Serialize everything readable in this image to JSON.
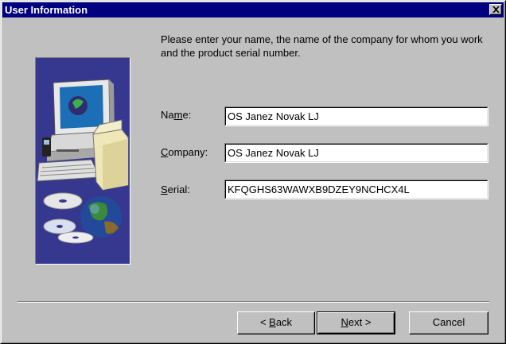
{
  "window": {
    "title": "User Information"
  },
  "intro_text": "Please enter your name, the name of the company for whom you work and the product serial number.",
  "form": {
    "name": {
      "label_mnemonic": "m",
      "label_pre": "Na",
      "label_post": "e:",
      "value": "OS Janez Novak LJ"
    },
    "company": {
      "label_mnemonic": "C",
      "label_pre": "",
      "label_post": "ompany:",
      "value": "OS Janez Novak LJ"
    },
    "serial": {
      "label_mnemonic": "S",
      "label_pre": "",
      "label_post": "erial:",
      "value": "KFQGHS63WAWXB9DZEY9NCHCX4L"
    }
  },
  "buttons": {
    "back": {
      "prefix": "< ",
      "mnemonic": "B",
      "rest": "ack"
    },
    "next": {
      "prefix": "",
      "mnemonic": "N",
      "rest": "ext >"
    },
    "cancel": "Cancel"
  },
  "colors": {
    "titlebar": "#000080",
    "face": "#c0c0c0",
    "art_background": "#36378f"
  },
  "icons": [
    "close-icon",
    "computer-illustration"
  ]
}
